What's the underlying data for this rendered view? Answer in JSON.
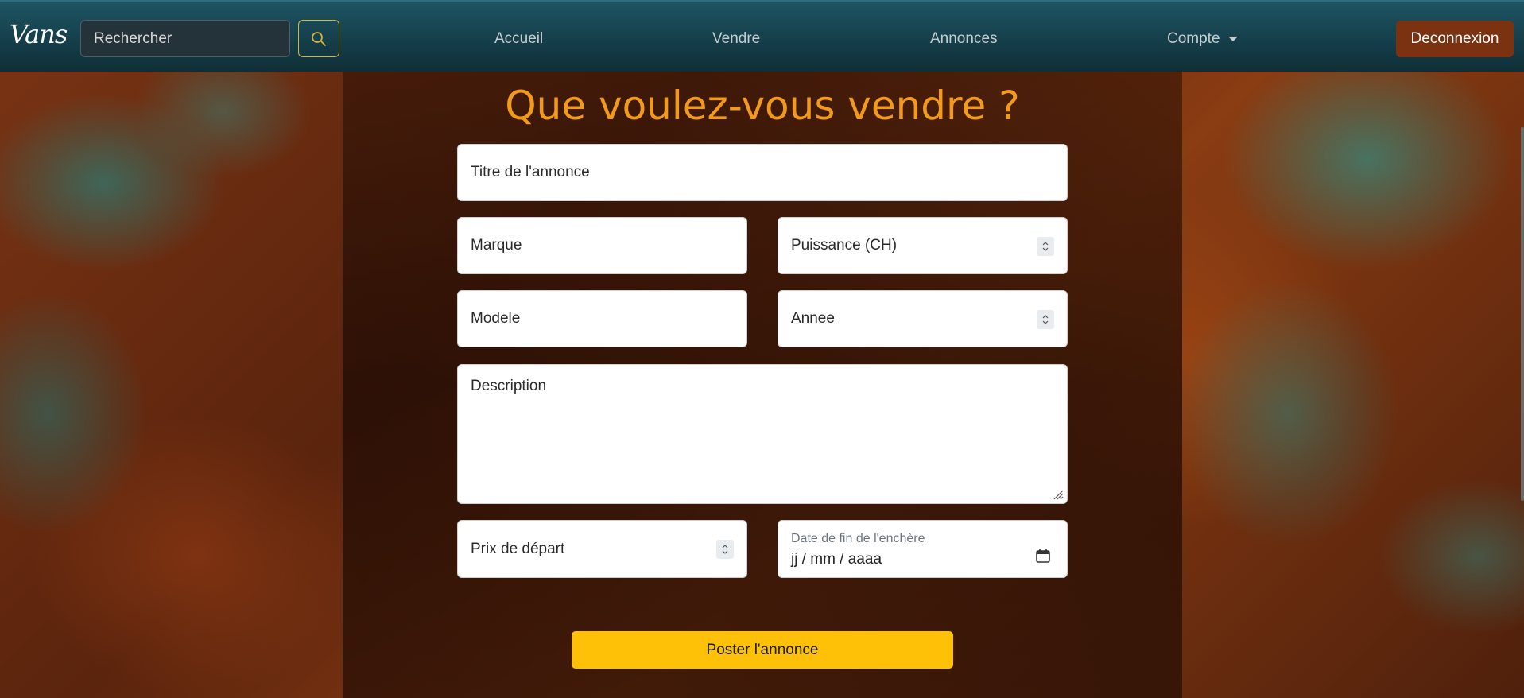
{
  "navbar": {
    "brand": "Vans",
    "search_placeholder": "Rechercher",
    "links": {
      "home": "Accueil",
      "sell": "Vendre",
      "listings": "Annonces",
      "account": "Compte"
    },
    "logout_label": "Deconnexion"
  },
  "main": {
    "title": "Que voulez-vous vendre ?",
    "fields": {
      "title_placeholder": "Titre de l'annonce",
      "brand_placeholder": "Marque",
      "power_placeholder": "Puissance (CH)",
      "model_placeholder": "Modele",
      "year_placeholder": "Annee",
      "description_placeholder": "Description",
      "price_placeholder": "Prix de départ",
      "end_date_label": "Date de fin de l'enchère",
      "end_date_value": "jj / mm / aaaa"
    },
    "submit_label": "Poster l'annonce"
  },
  "colors": {
    "title": "#f29a1a",
    "submit": "#ffc107",
    "logout": "#7b3211",
    "navbar": "#153f4b"
  }
}
